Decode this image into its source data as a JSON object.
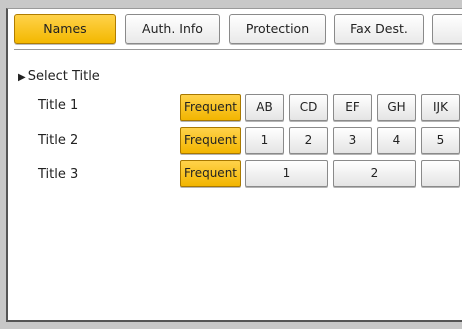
{
  "tabs": [
    "Names",
    "Auth. Info",
    "Protection",
    "Fax Dest."
  ],
  "select_title": {
    "heading": "Select Title",
    "rows": [
      {
        "label": "Title 1",
        "frequent": "Frequent",
        "keys": [
          "AB",
          "CD",
          "EF",
          "GH",
          "IJK"
        ]
      },
      {
        "label": "Title 2",
        "frequent": "Frequent",
        "keys": [
          "1",
          "2",
          "3",
          "4",
          "5"
        ]
      },
      {
        "label": "Title 3",
        "frequent": "Frequent",
        "keys": [
          "1",
          "2"
        ]
      }
    ]
  },
  "colors": {
    "accent": "#f5bd00",
    "frame": "#c8c8c8"
  }
}
